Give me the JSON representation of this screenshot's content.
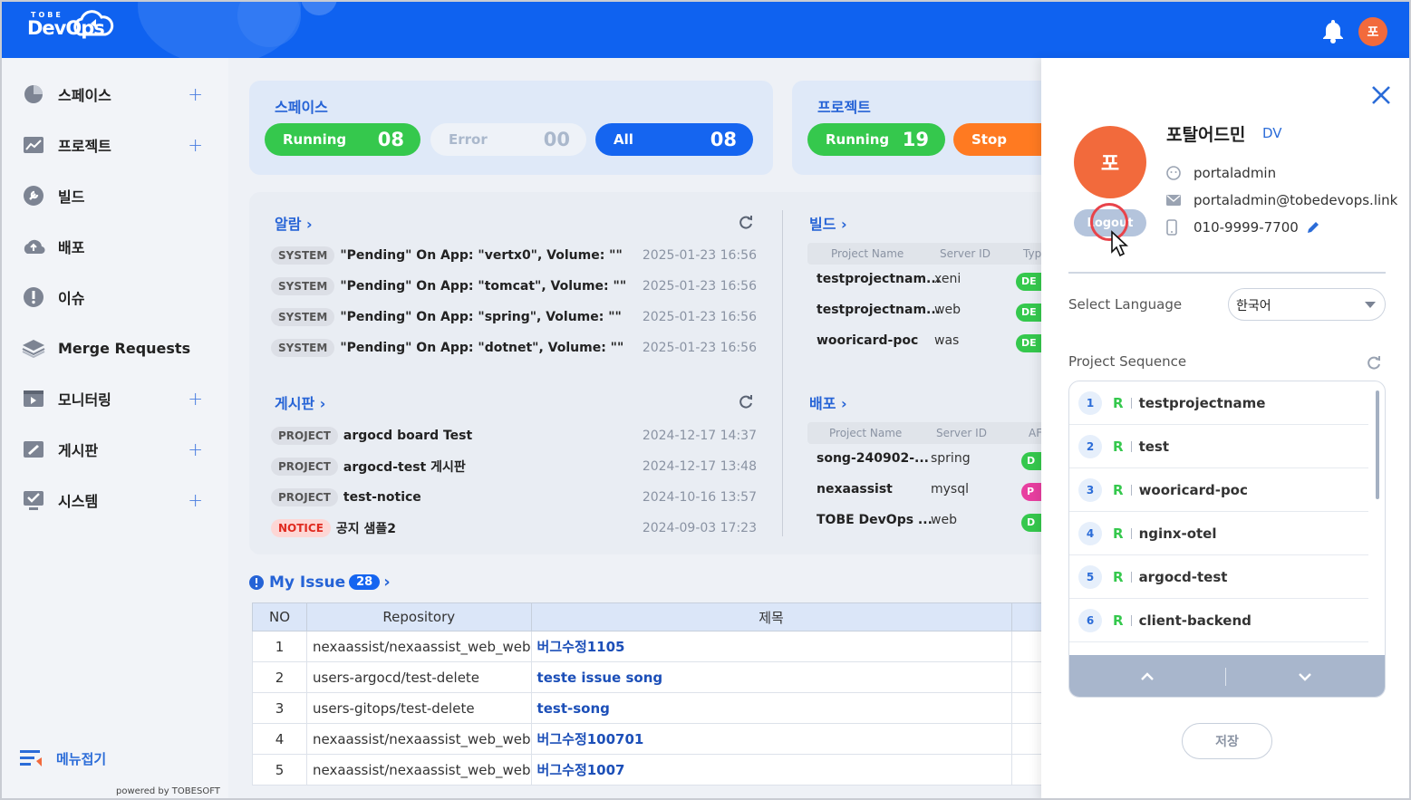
{
  "header": {
    "logo_small": "TOBE",
    "logo_big": "DevOps",
    "user_initial": "포",
    "icons": [
      "bell-icon",
      "avatar"
    ]
  },
  "sidebar": {
    "items": [
      {
        "label": "스페이스",
        "icon": "pie-chart-icon",
        "has_plus": true
      },
      {
        "label": "프로젝트",
        "icon": "chart-icon",
        "has_plus": true
      },
      {
        "label": "빌드",
        "icon": "wrench-icon",
        "has_plus": false
      },
      {
        "label": "배포",
        "icon": "cloud-upload-icon",
        "has_plus": false
      },
      {
        "label": "이슈",
        "icon": "alert-icon",
        "has_plus": false
      },
      {
        "label": "Merge Requests",
        "icon": "layers-icon",
        "has_plus": false
      },
      {
        "label": "모니터링",
        "icon": "monitor-icon",
        "has_plus": true
      },
      {
        "label": "게시판",
        "icon": "board-icon",
        "has_plus": true
      },
      {
        "label": "시스템",
        "icon": "system-icon",
        "has_plus": true
      }
    ],
    "plus": "+",
    "collapse_label": "메뉴접기",
    "powered": "powered by TOBESOFT"
  },
  "space_card": {
    "title": "스페이스",
    "running_label": "Running",
    "running_value": "08",
    "error_label": "Error",
    "error_value": "00",
    "all_label": "All",
    "all_value": "08"
  },
  "project_card": {
    "title": "프로젝트",
    "running_label": "Running",
    "running_value": "19",
    "stop_label": "Stop"
  },
  "alarm": {
    "title": "알람",
    "rows": [
      {
        "tag": "SYSTEM",
        "text": "\"Pending\" On App: \"vertx0\", Volume: \"\"",
        "date": "2025-01-23 16:56"
      },
      {
        "tag": "SYSTEM",
        "text": "\"Pending\" On App: \"tomcat\", Volume: \"\"",
        "date": "2025-01-23 16:56"
      },
      {
        "tag": "SYSTEM",
        "text": "\"Pending\" On App: \"spring\", Volume: \"\"",
        "date": "2025-01-23 16:56"
      },
      {
        "tag": "SYSTEM",
        "text": "\"Pending\" On App: \"dotnet\", Volume: \"\"",
        "date": "2025-01-23 16:56"
      }
    ]
  },
  "board": {
    "title": "게시판",
    "rows": [
      {
        "tag": "PROJECT",
        "text": "argocd board Test",
        "date": "2024-12-17 14:37"
      },
      {
        "tag": "PROJECT",
        "text": "argocd-test 게시판",
        "date": "2024-12-17 13:48"
      },
      {
        "tag": "PROJECT",
        "text": "test-notice",
        "date": "2024-10-16 13:57"
      },
      {
        "tag": "NOTICE",
        "text": "공지 샘플2",
        "date": "2024-09-03 17:23"
      }
    ]
  },
  "build": {
    "title": "빌드",
    "headers": [
      "Project Name",
      "Server ID",
      "Typ"
    ],
    "rows": [
      {
        "name": "testprojectnam...",
        "server": "xeni",
        "status": "DE"
      },
      {
        "name": "testprojectnam...",
        "server": "web",
        "status": "DE"
      },
      {
        "name": "wooricard-poc",
        "server": "was",
        "status": "DE"
      }
    ]
  },
  "deploy": {
    "title": "배포",
    "headers": [
      "Project Name",
      "Server ID",
      "AF"
    ],
    "rows": [
      {
        "name": "song-240902-...",
        "server": "spring",
        "status": "D",
        "color": "#35c84d"
      },
      {
        "name": "nexaassist",
        "server": "mysql",
        "status": "P",
        "color": "#e83fa0"
      },
      {
        "name": "TOBE DevOps ...",
        "server": "web",
        "status": "D",
        "color": "#35c84d"
      }
    ]
  },
  "my_issue": {
    "title": "My Issue",
    "count": "28",
    "headers": [
      "NO",
      "Repository",
      "제목"
    ],
    "rows": [
      {
        "no": "1",
        "repo": "nexaassist/nexaassist_web_web",
        "title": "버그수정1105"
      },
      {
        "no": "2",
        "repo": "users-argocd/test-delete",
        "title": "teste issue song"
      },
      {
        "no": "3",
        "repo": "users-gitops/test-delete",
        "title": "test-song"
      },
      {
        "no": "4",
        "repo": "nexaassist/nexaassist_web_web",
        "title": "버그수정100701"
      },
      {
        "no": "5",
        "repo": "nexaassist/nexaassist_web_web",
        "title": "버그수정1007"
      }
    ]
  },
  "profile": {
    "initial": "포",
    "name": "포탈어드민",
    "role": "DV",
    "logout_label": "Logout",
    "username": "portaladmin",
    "email": "portaladmin@tobedevops.link",
    "phone": "010-9999-7700",
    "language_label": "Select Language",
    "language_value": "한국어",
    "sequence_label": "Project Sequence",
    "sequence": [
      {
        "num": "1",
        "r": "R",
        "name": "testprojectname"
      },
      {
        "num": "2",
        "r": "R",
        "name": "test"
      },
      {
        "num": "3",
        "r": "R",
        "name": "wooricard-poc"
      },
      {
        "num": "4",
        "r": "R",
        "name": "nginx-otel"
      },
      {
        "num": "5",
        "r": "R",
        "name": "argocd-test"
      },
      {
        "num": "6",
        "r": "R",
        "name": "client-backend"
      }
    ],
    "save_label": "저장"
  },
  "colors": {
    "header": "#0f62f0",
    "accent": "#2563d6",
    "running": "#35c84d",
    "stop": "#ff7a21",
    "avatar": "#f26a3c"
  }
}
